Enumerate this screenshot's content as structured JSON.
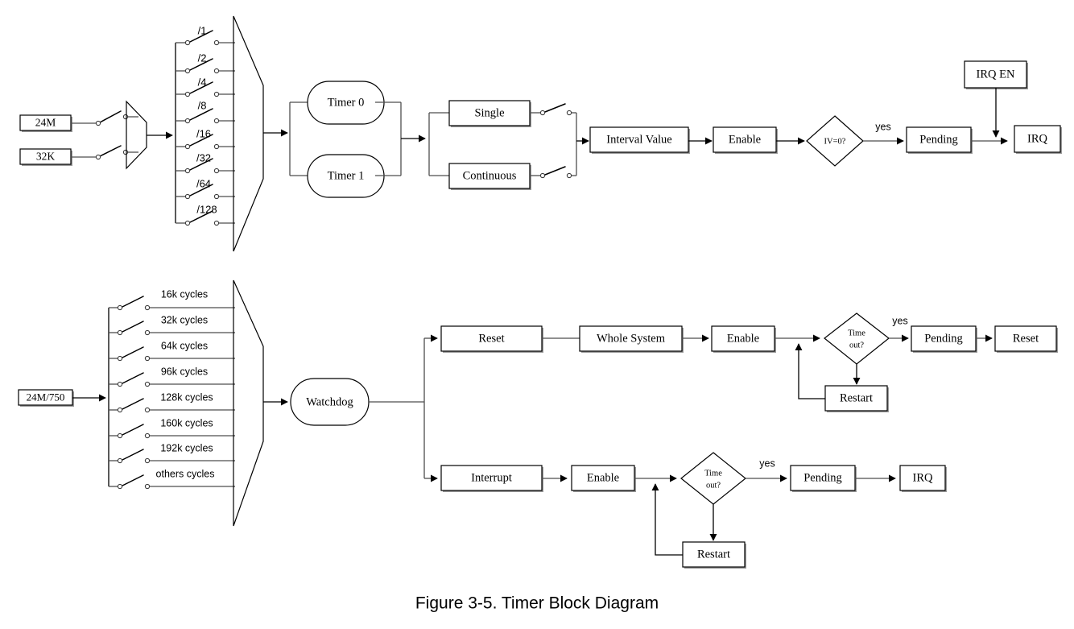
{
  "figure": {
    "caption": "Figure 3-5. Timer Block Diagram",
    "colors": {
      "line": "#4d4d4d",
      "outline": "#000000",
      "background": "#ffffff",
      "shadow": "#9a9a9a"
    }
  },
  "timer_section": {
    "clock_sources": [
      {
        "label": "24M"
      },
      {
        "label": "32K"
      }
    ],
    "source_mux": {
      "name": "clock-source-mux"
    },
    "dividers": [
      {
        "label": "/1"
      },
      {
        "label": "/2"
      },
      {
        "label": "/4"
      },
      {
        "label": "/8"
      },
      {
        "label": "/16"
      },
      {
        "label": "/32"
      },
      {
        "label": "/64"
      },
      {
        "label": "/128"
      }
    ],
    "divider_mux": {
      "name": "divider-mux"
    },
    "timers": [
      {
        "label": "Timer 0"
      },
      {
        "label": "Timer 1"
      }
    ],
    "modes": [
      {
        "label": "Single"
      },
      {
        "label": "Continuous"
      }
    ],
    "chain": [
      {
        "label": "Interval Value"
      },
      {
        "label": "Enable"
      }
    ],
    "decision": {
      "label_line1": "IV=0?",
      "yes_label": "yes"
    },
    "pending": {
      "label": "Pending"
    },
    "irq_enable": {
      "label": "IRQ EN"
    },
    "irq": {
      "label": "IRQ"
    }
  },
  "watchdog_section": {
    "clock_source": {
      "label": "24M/750"
    },
    "cycles": [
      {
        "label": "16k cycles"
      },
      {
        "label": "32k cycles"
      },
      {
        "label": "64k cycles"
      },
      {
        "label": "96k cycles"
      },
      {
        "label": "128k cycles"
      },
      {
        "label": "160k cycles"
      },
      {
        "label": "192k cycles"
      },
      {
        "label": "others cycles"
      }
    ],
    "cycles_mux": {
      "name": "watchdog-mux"
    },
    "watchdog": {
      "label": "Watchdog"
    },
    "reset_branch": {
      "reset": {
        "label": "Reset"
      },
      "whole_system": {
        "label": "Whole System"
      },
      "enable": {
        "label": "Enable"
      },
      "decision": {
        "label_line1": "Time",
        "label_line2": "out?",
        "yes_label": "yes"
      },
      "restart": {
        "label": "Restart"
      },
      "pending": {
        "label": "Pending"
      },
      "output": {
        "label": "Reset"
      }
    },
    "interrupt_branch": {
      "interrupt": {
        "label": "Interrupt"
      },
      "enable": {
        "label": "Enable"
      },
      "decision": {
        "label_line1": "Time",
        "label_line2": "out?",
        "yes_label": "yes"
      },
      "restart": {
        "label": "Restart"
      },
      "pending": {
        "label": "Pending"
      },
      "output": {
        "label": "IRQ"
      }
    }
  }
}
